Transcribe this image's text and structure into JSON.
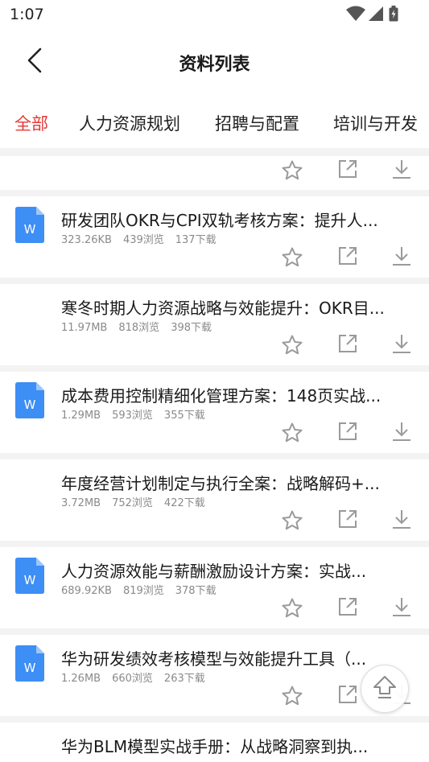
{
  "status_bar": {
    "time": "1:07"
  },
  "header": {
    "title": "资料列表"
  },
  "tabs": [
    {
      "label": "全部",
      "active": true
    },
    {
      "label": "人力资源规划",
      "active": false
    },
    {
      "label": "招聘与配置",
      "active": false
    },
    {
      "label": "培训与开发",
      "active": false
    }
  ],
  "colors": {
    "accent": "#e53935",
    "doc_icon": "#3d8ef5",
    "icon_gray": "#9a9a9a",
    "meta_gray": "#8a8a8a"
  },
  "items": [
    {
      "title": "研发团队OKR与CPI双轨考核方案：提升人...",
      "size": "323.26KB",
      "views": "439浏览",
      "downloads": "137下载",
      "has_icon": true
    },
    {
      "title": "寒冬时期人力资源战略与效能提升：OKR目...",
      "size": "11.97MB",
      "views": "818浏览",
      "downloads": "398下载",
      "has_icon": false
    },
    {
      "title": "成本费用控制精细化管理方案：148页实战...",
      "size": "1.29MB",
      "views": "593浏览",
      "downloads": "355下载",
      "has_icon": true
    },
    {
      "title": "年度经营计划制定与执行全案：战略解码+...",
      "size": "3.72MB",
      "views": "752浏览",
      "downloads": "422下载",
      "has_icon": false
    },
    {
      "title": "人力资源效能与薪酬激励设计方案：实战...",
      "size": "689.92KB",
      "views": "819浏览",
      "downloads": "378下载",
      "has_icon": true
    },
    {
      "title": "华为研发绩效考核模型与效能提升工具（...",
      "size": "1.26MB",
      "views": "660浏览",
      "downloads": "263下载",
      "has_icon": true
    },
    {
      "title": "华为BLM模型实战手册：从战略洞察到执...",
      "size": "",
      "views": "",
      "downloads": "",
      "has_icon": false
    }
  ],
  "doc_icon_letter": "W",
  "icons": {
    "favorite": "star-outline-icon",
    "share": "share-icon",
    "download": "download-icon",
    "back_to_top": "arrow-up-icon"
  }
}
